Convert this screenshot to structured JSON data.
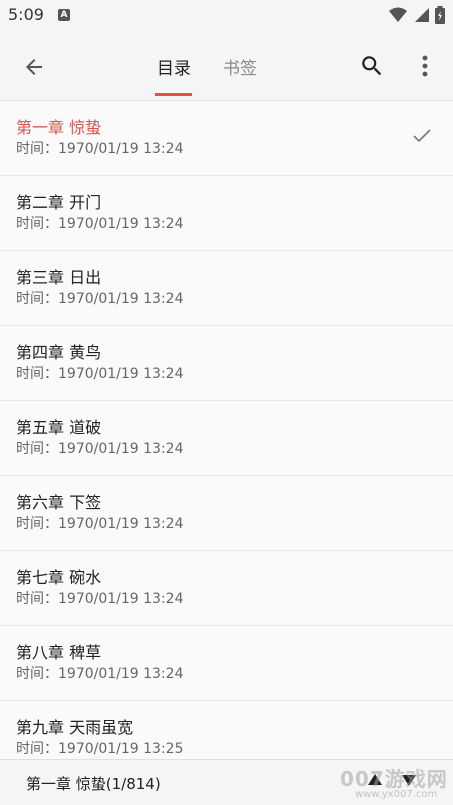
{
  "status_bar": {
    "time": "5:09",
    "notification": "A"
  },
  "header": {
    "tabs": [
      {
        "label": "目录",
        "active": true
      },
      {
        "label": "书签",
        "active": false
      }
    ]
  },
  "colors": {
    "accent": "#d9534f"
  },
  "chapters": [
    {
      "title": "第一章 惊蛰",
      "time": "时间：1970/01/19 13:24",
      "current": true
    },
    {
      "title": "第二章 开门",
      "time": "时间：1970/01/19 13:24"
    },
    {
      "title": "第三章 日出",
      "time": "时间：1970/01/19 13:24"
    },
    {
      "title": "第四章 黄鸟",
      "time": "时间：1970/01/19 13:24"
    },
    {
      "title": "第五章 道破",
      "time": "时间：1970/01/19 13:24"
    },
    {
      "title": "第六章 下签",
      "time": "时间：1970/01/19 13:24"
    },
    {
      "title": "第七章 碗水",
      "time": "时间：1970/01/19 13:24"
    },
    {
      "title": "第八章 稗草",
      "time": "时间：1970/01/19 13:24"
    },
    {
      "title": "第九章 天雨虽宽",
      "time": "时间：1970/01/19 13:25"
    }
  ],
  "footer": {
    "current_chapter": "第一章 惊蛰(1/814)"
  },
  "watermark": {
    "text": "007游戏网",
    "sub": "www.yx007.com"
  }
}
